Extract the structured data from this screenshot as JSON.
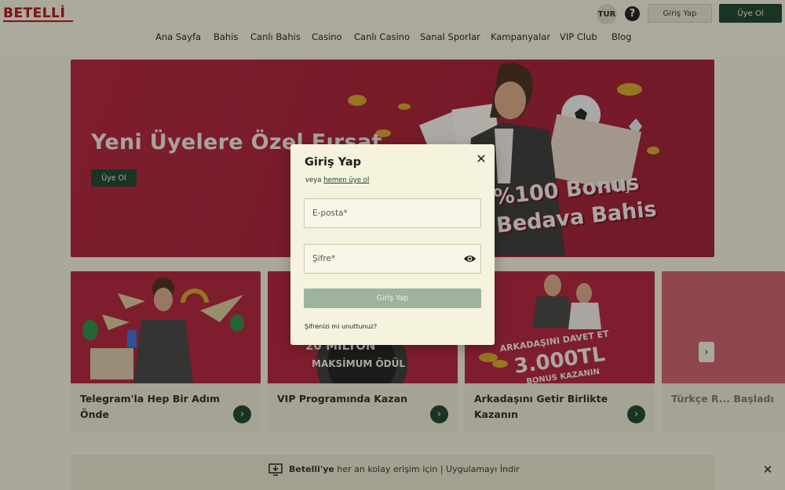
{
  "header": {
    "logo_text": "BETELLİ",
    "language": "TUR",
    "help_symbol": "?",
    "login_label": "Giriş Yap",
    "register_label": "Üye Ol"
  },
  "nav": {
    "items": [
      "Ana Sayfa",
      "Bahis",
      "Canlı Bahis",
      "Casino",
      "Canlı Casino",
      "Sanal Sporlar",
      "Kampanyalar",
      "VIP Club",
      "Blog"
    ]
  },
  "hero": {
    "title": "Yeni Üyelere Özel Fırsat",
    "cta_label": "Üye Ol",
    "bonus_line1": "%100 Bonus",
    "bonus_line2": "Bedava Bahis"
  },
  "cards": [
    {
      "title": "Telegram'la Hep Bir Adım Önde"
    },
    {
      "title": "VIP Programında Kazan",
      "image_text_line1": "20 MİLYON",
      "image_text_line2": "MAKSİMUM ÖDÜL"
    },
    {
      "title": "Arkadaşını Getir Birlikte Kazanın",
      "image_text_line1": "ARKADAŞINI DAVET ET",
      "image_text_line2": "3.000TL",
      "image_text_line3": "BONUS KAZANIN"
    },
    {
      "title": "Türkçe R... Başladı"
    }
  ],
  "app_banner": {
    "brand": "Betelli'ye",
    "text": " her an kolay erişim için | Uygulamayı İndir"
  },
  "modal": {
    "title": "Giriş Yap",
    "subtitle_prefix": "veya ",
    "subtitle_link": "hemen üye ol",
    "email_placeholder": "E-posta*",
    "password_placeholder": "Şifre*",
    "submit_label": "Giriş Yap",
    "forgot_label": "Şifrenizi mi unuttunuz?"
  },
  "colors": {
    "brand_red": "#b0151f",
    "accent_green": "#1d4430",
    "hero_red": "#a81f36",
    "background": "#f2efdc"
  }
}
